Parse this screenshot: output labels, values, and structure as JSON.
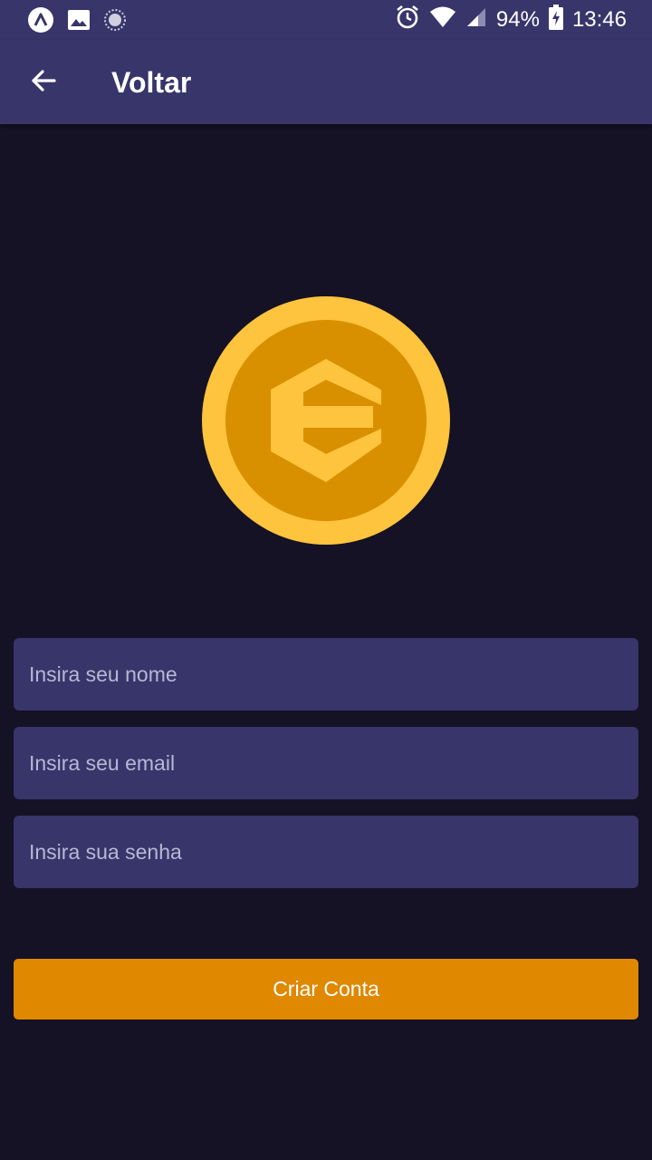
{
  "status_bar": {
    "battery": "94%",
    "time": "13:46",
    "icons": [
      "app-a-icon",
      "image-icon",
      "sync-icon",
      "alarm-icon",
      "wifi-icon",
      "signal-icon",
      "battery-charging-icon"
    ]
  },
  "app_bar": {
    "back_icon": "arrow-left-icon",
    "title": "Voltar"
  },
  "logo": {
    "icon": "coin-e-logo",
    "colors": {
      "outer": "#ffc43d",
      "inner": "#d99000"
    }
  },
  "form": {
    "name_placeholder": "Insira seu nome",
    "email_placeholder": "Insira seu email",
    "password_placeholder": "Insira sua senha",
    "name_value": "",
    "email_value": "",
    "password_value": ""
  },
  "actions": {
    "create_account_label": "Criar Conta"
  },
  "colors": {
    "background": "#141224",
    "surface": "#37356a",
    "accent": "#df8800"
  }
}
